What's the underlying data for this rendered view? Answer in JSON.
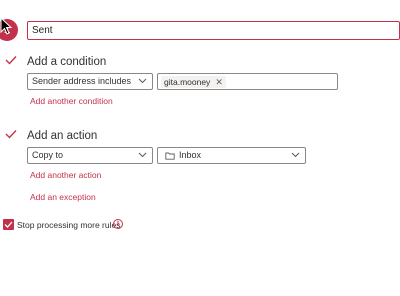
{
  "step": {
    "number": "1"
  },
  "rule_name": {
    "value": "Sent"
  },
  "condition": {
    "title": "Add a condition",
    "field_select": "Sender address includes",
    "chip_value": "gita.mooney",
    "add_link": "Add another condition"
  },
  "action": {
    "title": "Add an action",
    "action_select": "Copy to",
    "folder_select": "Inbox",
    "add_link": "Add another action",
    "exception_link": "Add an exception"
  },
  "stop_processing": {
    "label": "Stop processing more rules",
    "checked": true
  },
  "colors": {
    "accent": "#c4314b",
    "border": "#8a8886"
  },
  "icons": {
    "cursor": "pointer-cursor-icon",
    "check": "checkmark-icon",
    "chevron": "chevron-down-icon",
    "folder": "folder-icon",
    "remove": "close-icon",
    "info": "info-icon"
  }
}
